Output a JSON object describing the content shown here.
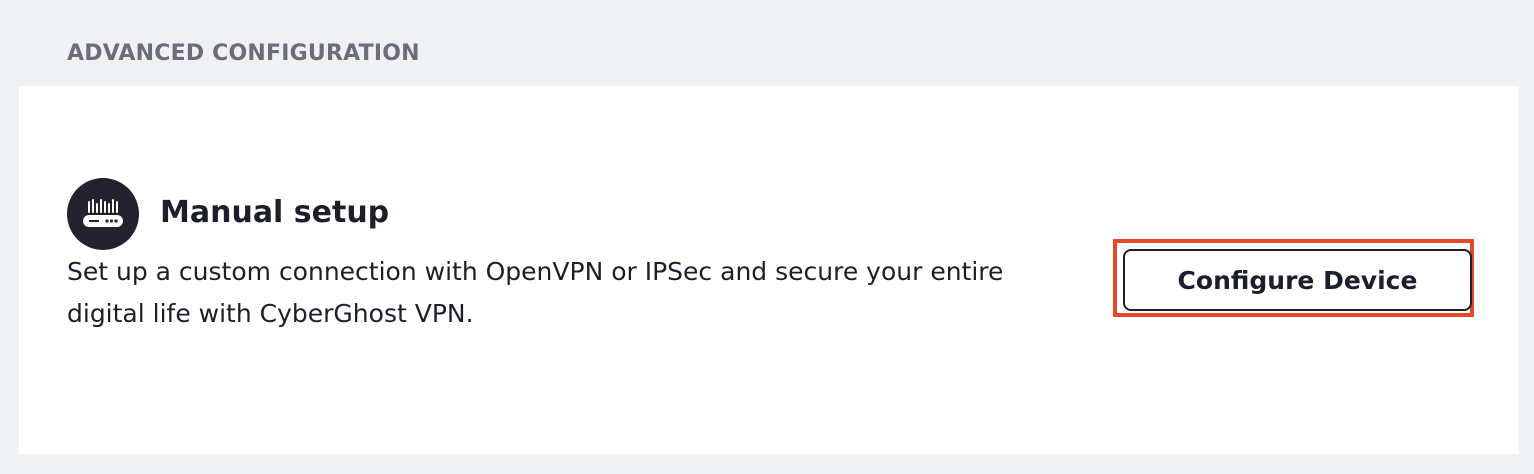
{
  "section": {
    "header": "ADVANCED CONFIGURATION"
  },
  "manual_setup": {
    "icon": "router-icon",
    "title": "Manual setup",
    "description": "Set up a custom connection with OpenVPN or IPSec and secure your entire digital life with CyberGhost VPN.",
    "button_label": "Configure Device"
  },
  "colors": {
    "page_background": "#f0f1f3",
    "card_background": "#ffffff",
    "header_text": "#6c6c7b",
    "primary_text": "#1d1e2b",
    "icon_background": "#22232f",
    "highlight_border": "#e24a2b"
  }
}
